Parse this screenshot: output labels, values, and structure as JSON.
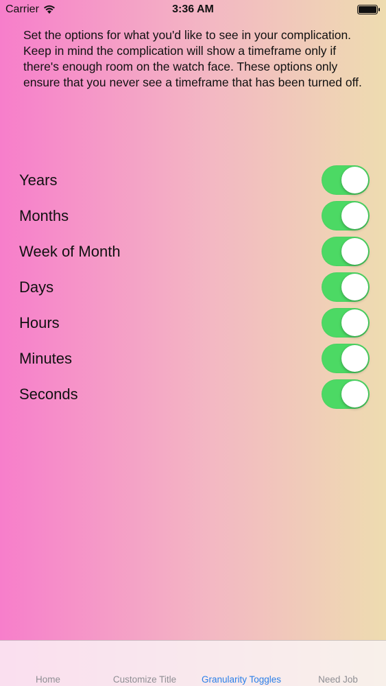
{
  "status_bar": {
    "carrier": "Carrier",
    "time": "3:36 AM"
  },
  "description": "Set the options for what you'd like to see in your complication. Keep in mind the complication will show a timeframe only if there's enough room on the watch face. These options only ensure that you never see a timeframe that has been turned off.",
  "toggles": [
    {
      "label": "Years",
      "on": true
    },
    {
      "label": "Months",
      "on": true
    },
    {
      "label": "Week of Month",
      "on": true
    },
    {
      "label": "Days",
      "on": true
    },
    {
      "label": "Hours",
      "on": true
    },
    {
      "label": "Minutes",
      "on": true
    },
    {
      "label": "Seconds",
      "on": true
    }
  ],
  "tab_bar": {
    "tabs": [
      {
        "label": "Home",
        "active": false
      },
      {
        "label": "Customize Title",
        "active": false
      },
      {
        "label": "Granularity Toggles",
        "active": true
      },
      {
        "label": "Need Job",
        "active": false
      }
    ]
  },
  "colors": {
    "switch_on": "#4cd964",
    "active_tab": "#2a7fe8",
    "inactive_tab": "#8e8e93",
    "gradient_left": "#f77ecb",
    "gradient_right": "#eedcb0"
  }
}
